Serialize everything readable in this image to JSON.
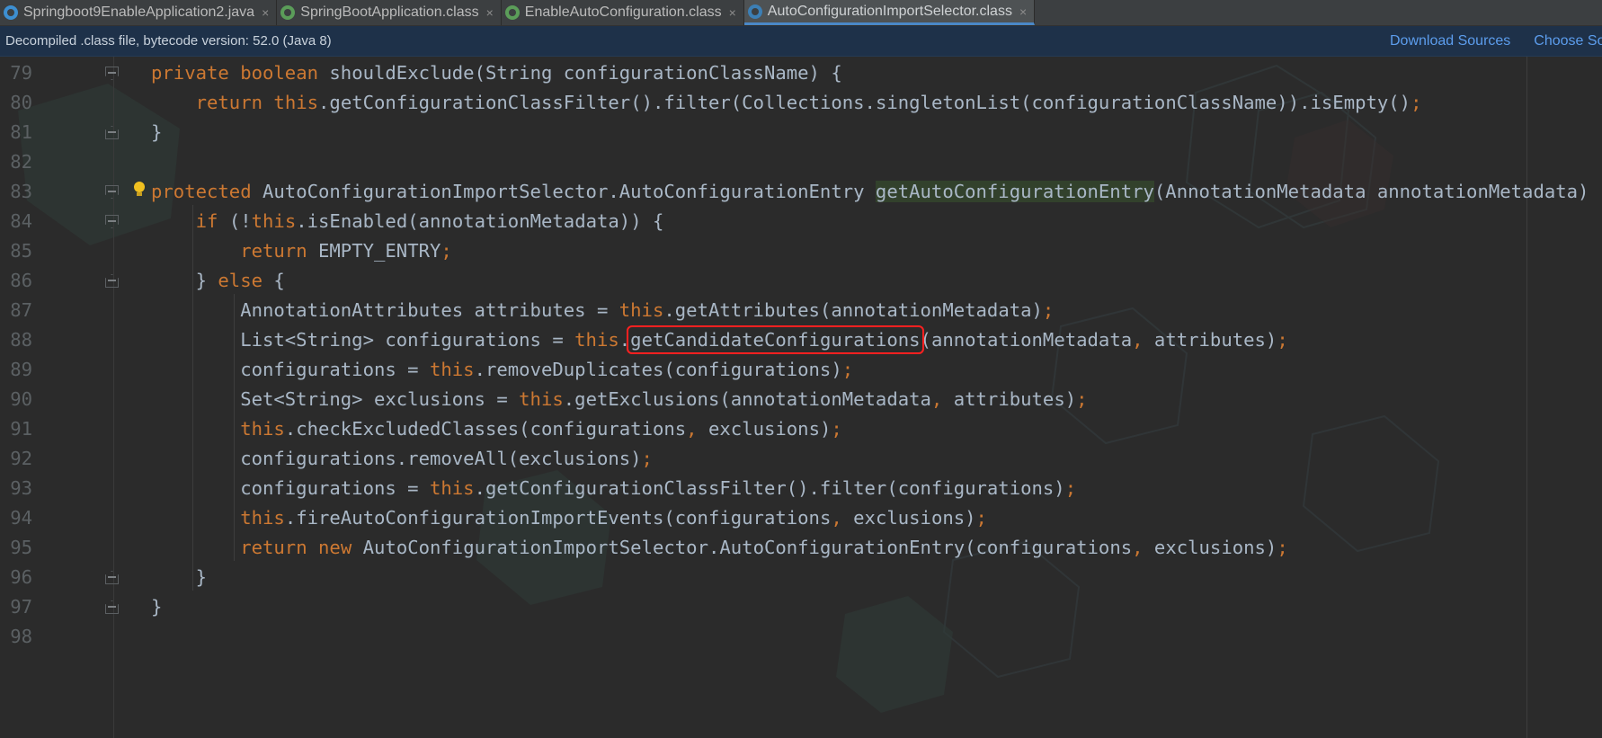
{
  "tabs": [
    {
      "label": "Springboot9EnableApplication2.java",
      "icon": "java-class-icon",
      "close": "×",
      "active": false
    },
    {
      "label": "SpringBootApplication.class",
      "icon": "class-file-icon",
      "close": "×",
      "active": false
    },
    {
      "label": "EnableAutoConfiguration.class",
      "icon": "class-file-icon",
      "close": "×",
      "active": false
    },
    {
      "label": "AutoConfigurationImportSelector.class",
      "icon": "class-file-icon",
      "close": "×",
      "active": true
    }
  ],
  "notification": {
    "message": "Decompiled .class file, bytecode version: 52.0 (Java 8)",
    "download_sources": "Download Sources",
    "choose_sources": "Choose Sources..."
  },
  "editor": {
    "highlighted_method": "getCandidateConfigurations",
    "lines": [
      {
        "num": "79",
        "code": "private boolean shouldExclude(String configurationClassName) {"
      },
      {
        "num": "80",
        "code": "    return this.getConfigurationClassFilter().filter(Collections.singletonList(configurationClassName)).isEmpty();"
      },
      {
        "num": "81",
        "code": "}"
      },
      {
        "num": "82",
        "code": ""
      },
      {
        "num": "83",
        "code": "protected AutoConfigurationImportSelector.AutoConfigurationEntry getAutoConfigurationEntry(AnnotationMetadata annotationMetadata) {"
      },
      {
        "num": "84",
        "code": "    if (!this.isEnabled(annotationMetadata)) {"
      },
      {
        "num": "85",
        "code": "        return EMPTY_ENTRY;"
      },
      {
        "num": "86",
        "code": "    } else {"
      },
      {
        "num": "87",
        "code": "        AnnotationAttributes attributes = this.getAttributes(annotationMetadata);"
      },
      {
        "num": "88",
        "code": "        List<String> configurations = this.getCandidateConfigurations(annotationMetadata, attributes);"
      },
      {
        "num": "89",
        "code": "        configurations = this.removeDuplicates(configurations);"
      },
      {
        "num": "90",
        "code": "        Set<String> exclusions = this.getExclusions(annotationMetadata, attributes);"
      },
      {
        "num": "91",
        "code": "        this.checkExcludedClasses(configurations, exclusions);"
      },
      {
        "num": "92",
        "code": "        configurations.removeAll(exclusions);"
      },
      {
        "num": "93",
        "code": "        configurations = this.getConfigurationClassFilter().filter(configurations);"
      },
      {
        "num": "94",
        "code": "        this.fireAutoConfigurationImportEvents(configurations, exclusions);"
      },
      {
        "num": "95",
        "code": "        return new AutoConfigurationImportSelector.AutoConfigurationEntry(configurations, exclusions);"
      },
      {
        "num": "96",
        "code": "    }"
      },
      {
        "num": "97",
        "code": "}"
      },
      {
        "num": "98",
        "code": ""
      }
    ]
  },
  "colors": {
    "keyword": "#cc7832",
    "text": "#a9b7c6",
    "line_number": "#5b6063",
    "highlight_box": "#ff2020",
    "link": "#5c9ded"
  }
}
